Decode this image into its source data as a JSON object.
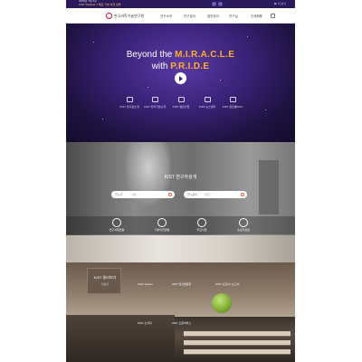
{
  "topbar": {
    "line1": "2020년 7월 4주",
    "line2": "KIST Webinar 7 특집 기술 이전 설명",
    "right": "▶ 더 보기"
  },
  "nav": {
    "logo_text": "한국과학기술연구원",
    "menus": [
      "연구소개",
      "연구분야",
      "열린참여",
      "연구실",
      "인재채용"
    ]
  },
  "hero": {
    "line1_prefix": "Beyond the ",
    "line1_em": "M.I.R.A.C.L.E",
    "line2_prefix": "with ",
    "line2_em": "P.R.I.D.E",
    "icons": [
      {
        "label": "KIST 연구원소개",
        "icon": "building-icon"
      },
      {
        "label": "KIST 과학기술소개",
        "icon": "flask-icon"
      },
      {
        "label": "KIST 열린사업",
        "icon": "book-icon"
      },
      {
        "label": "KIST 뉴스센터",
        "icon": "news-icon"
      },
      {
        "label": "KIST 글로벌KIST",
        "icon": "globe-icon"
      }
    ]
  },
  "search": {
    "title": "KIST 연구자검색",
    "box1": {
      "select": "연구자",
      "placeholder": "이름"
    },
    "box2": {
      "select": "연구분야",
      "placeholder": "키워드"
    },
    "quicklinks": [
      {
        "label": "연구과제현황",
        "icon": "chart-icon"
      },
      {
        "label": "기술이전현황",
        "icon": "handshake-icon"
      },
      {
        "label": "주요사업",
        "icon": "target-icon"
      },
      {
        "label": "홍보자료실",
        "icon": "monitor-icon"
      }
    ]
  },
  "bottom": {
    "box_title": "KIST 둘러보기",
    "box_sub": "더보기",
    "links": [
      "KIST School",
      "KIST 연구발표회",
      "KIST 브로셔 / 보고서",
      "KIST 소식지",
      "KIST 오픈하우스"
    ]
  },
  "colors": {
    "hero_bg": "#3a2378",
    "accent_orange": "#ffb020",
    "brand_red": "#c8102e"
  }
}
